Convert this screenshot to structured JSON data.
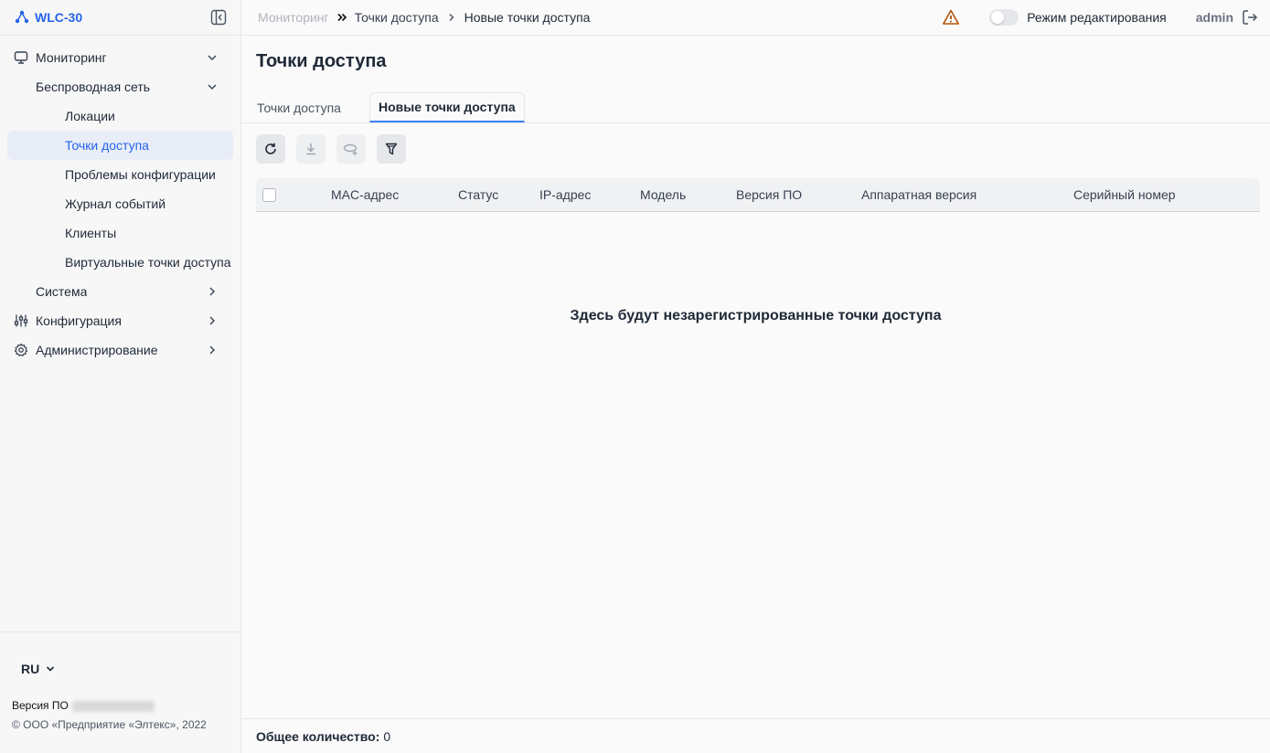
{
  "app": {
    "name": "WLC-30"
  },
  "sidebar": {
    "items": [
      {
        "label": "Мониторинг"
      },
      {
        "label": "Беспроводная сеть"
      },
      {
        "label": "Локации"
      },
      {
        "label": "Точки доступа"
      },
      {
        "label": "Проблемы конфигурации"
      },
      {
        "label": "Журнал событий"
      },
      {
        "label": "Клиенты"
      },
      {
        "label": "Виртуальные точки доступа"
      },
      {
        "label": "Система"
      },
      {
        "label": "Конфигурация"
      },
      {
        "label": "Администрирование"
      }
    ],
    "active_index": 3,
    "language": "RU",
    "version_label": "Версия ПО",
    "copyright": "© ООО «Предприятие «Элтекс», 2022"
  },
  "breadcrumb": [
    "Мониторинг",
    "Точки доступа",
    "Новые точки доступа"
  ],
  "topbar": {
    "edit_mode_label": "Режим редактирования",
    "edit_mode_on": false,
    "user": "admin"
  },
  "page": {
    "title": "Точки доступа",
    "tabs": [
      {
        "label": "Точки доступа"
      },
      {
        "label": "Новые точки доступа"
      }
    ],
    "active_tab": 1,
    "columns": [
      "MAC-адрес",
      "Статус",
      "IP-адрес",
      "Модель",
      "Версия ПО",
      "Аппаратная версия",
      "Серийный номер"
    ],
    "empty_message": "Здесь будут незарегистрированные точки доступа",
    "total_label": "Общее количество:",
    "total_value": "0"
  },
  "colors": {
    "accent": "#2563eb",
    "active_bg": "#e8edf7",
    "warning": "#b45309"
  }
}
